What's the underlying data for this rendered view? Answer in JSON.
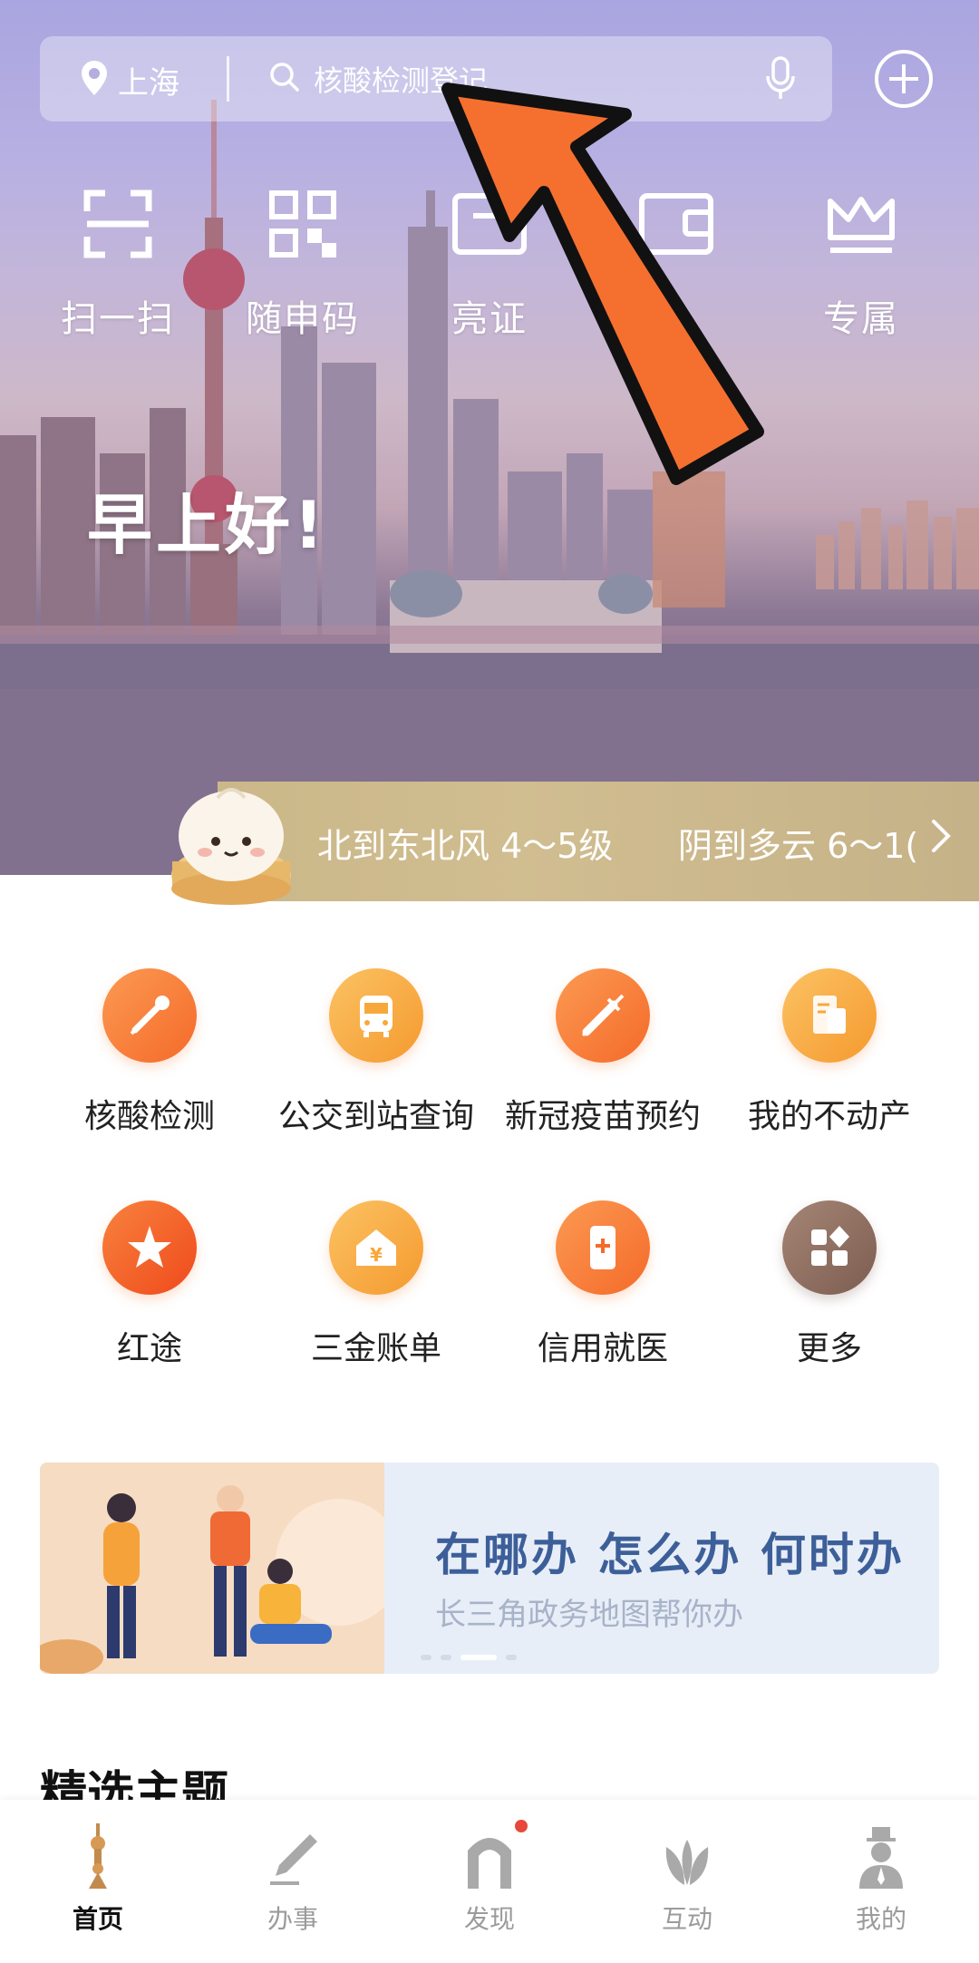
{
  "search": {
    "location": "上海",
    "placeholder": "核酸检测登记"
  },
  "quick_actions": [
    {
      "label": "扫一扫",
      "icon": "scan-icon"
    },
    {
      "label": "随申码",
      "icon": "qrcode-icon"
    },
    {
      "label": "亮证",
      "icon": "id-card-icon"
    },
    {
      "label": "",
      "icon": "wallet-icon"
    },
    {
      "label": "专属",
      "icon": "crown-icon"
    }
  ],
  "greeting": "早上好!",
  "weather": {
    "wind": "北到东北风 4～5级",
    "forecast": "阴到多云 6～1("
  },
  "services": [
    {
      "label": "核酸检测",
      "icon": "swab-icon",
      "color": "#f7772f"
    },
    {
      "label": "公交到站查询",
      "icon": "bus-icon",
      "color": "#f6a23a"
    },
    {
      "label": "新冠疫苗预约",
      "icon": "syringe-icon",
      "color": "#f7772f"
    },
    {
      "label": "我的不动产",
      "icon": "document-icon",
      "color": "#f6a23a"
    },
    {
      "label": "红途",
      "icon": "star-icon",
      "color": "#f35a24"
    },
    {
      "label": "三金账单",
      "icon": "house-yen-icon",
      "color": "#f6a23a"
    },
    {
      "label": "信用就医",
      "icon": "phone-medical-icon",
      "color": "#f7772f"
    },
    {
      "label": "更多",
      "icon": "grid-more-icon",
      "color": "#8d6e63"
    }
  ],
  "banner": {
    "title": "在哪办 怎么办 何时办",
    "subtitle": "长三角政务地图帮你办"
  },
  "section_title": "精选主题",
  "tabs": [
    {
      "label": "首页",
      "icon": "tower-icon",
      "active": true
    },
    {
      "label": "办事",
      "icon": "pen-icon",
      "active": false
    },
    {
      "label": "发现",
      "icon": "arch-icon",
      "active": false,
      "badge": true
    },
    {
      "label": "互动",
      "icon": "lotus-icon",
      "active": false
    },
    {
      "label": "我的",
      "icon": "person-icon",
      "active": false
    }
  ]
}
